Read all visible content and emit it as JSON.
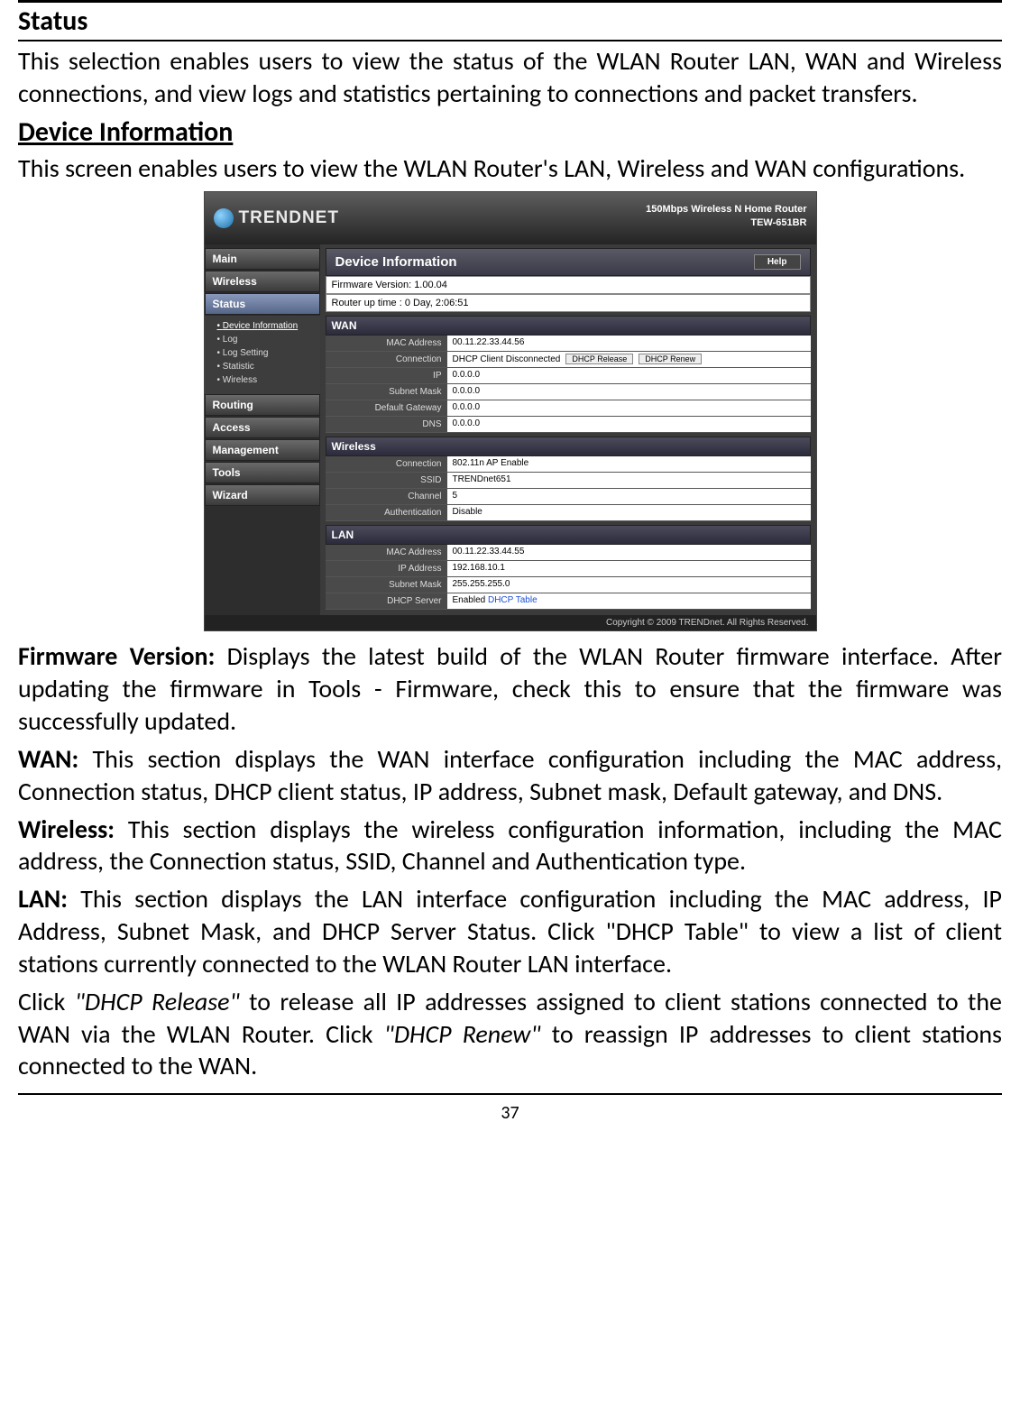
{
  "page": {
    "title": "Status",
    "intro": "This selection enables users to view the status of the WLAN Router LAN, WAN and Wireless connections, and view logs and statistics pertaining to connections and packet transfers.",
    "subsection": "Device Information",
    "subsection_intro": "This screen enables users to view the WLAN Router's LAN, Wireless and WAN configurations.",
    "firmware_label": "Firmware Version:",
    "firmware_text": " Displays the latest build of the WLAN Router firmware interface. After updating the firmware in Tools - Firmware, check this to ensure that the firmware was successfully updated.",
    "wan_label": "WAN:",
    "wan_text": " This section displays the WAN interface configuration including the MAC address, Connection status, DHCP client status, IP address, Subnet mask, Default gateway, and DNS.",
    "wireless_label": "Wireless:",
    "wireless_text": " This section displays the wireless configuration information, including the MAC address, the Connection status, SSID, Channel and Authentication type.",
    "lan_label": "LAN:",
    "lan_text": " This section displays the LAN interface configuration including the MAC address, IP Address, Subnet Mask, and DHCP Server Status. Click \"DHCP Table\" to view a list of client stations currently connected to the WLAN Router LAN interface.",
    "dhcp_text_1": "Click ",
    "dhcp_release": "\"DHCP Release\"",
    "dhcp_text_2": " to release all IP addresses assigned to client stations connected to the WAN via the WLAN Router. Click ",
    "dhcp_renew": "\"DHCP Renew\"",
    "dhcp_text_3": " to reassign IP addresses to client stations connected to the WAN.",
    "page_number": "37"
  },
  "router": {
    "brand": "TRENDNET",
    "model_line1": "150Mbps Wireless N Home Router",
    "model_line2": "TEW-651BR",
    "nav": {
      "main": "Main",
      "wireless": "Wireless",
      "status": "Status",
      "routing": "Routing",
      "access": "Access",
      "management": "Management",
      "tools": "Tools",
      "wizard": "Wizard"
    },
    "subnav": {
      "device_info": "Device Information",
      "log": "Log",
      "log_setting": "Log Setting",
      "statistic": "Statistic",
      "wireless": "Wireless"
    },
    "panel_title": "Device Information",
    "help": "Help",
    "firmware_version_label": "Firmware Version: 1.00.04",
    "uptime_label": "Router up time :  0 Day, 2:06:51",
    "wan": {
      "header": "WAN",
      "mac_label": "MAC Address",
      "mac": "00.11.22.33.44.56",
      "conn_label": "Connection",
      "conn": "DHCP Client Disconnected",
      "release_btn": "DHCP Release",
      "renew_btn": "DHCP Renew",
      "ip_label": "IP",
      "ip": "0.0.0.0",
      "mask_label": "Subnet Mask",
      "mask": "0.0.0.0",
      "gw_label": "Default Gateway",
      "gw": "0.0.0.0",
      "dns_label": "DNS",
      "dns": "0.0.0.0"
    },
    "wireless": {
      "header": "Wireless",
      "conn_label": "Connection",
      "conn": "802.11n AP Enable",
      "ssid_label": "SSID",
      "ssid": "TRENDnet651",
      "channel_label": "Channel",
      "channel": "5",
      "auth_label": "Authentication",
      "auth": "Disable"
    },
    "lan": {
      "header": "LAN",
      "mac_label": "MAC Address",
      "mac": "00.11.22.33.44.55",
      "ip_label": "IP Address",
      "ip": "192.168.10.1",
      "mask_label": "Subnet Mask",
      "mask": "255.255.255.0",
      "dhcp_label": "DHCP Server",
      "dhcp": "Enabled",
      "dhcp_link": "DHCP Table"
    },
    "footer": "Copyright © 2009 TRENDnet. All Rights Reserved."
  }
}
